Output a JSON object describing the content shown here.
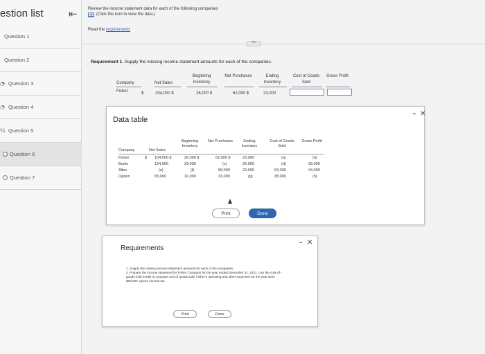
{
  "sidebar": {
    "title": "estion list",
    "collapse_icon": "double-chevron-left-icon",
    "questions": [
      {
        "label": "Question 1",
        "icon": "",
        "status": "none"
      },
      {
        "label": "Question 2",
        "icon": "",
        "status": "none"
      },
      {
        "label": "Question 3",
        "icon": "partial-circle-icon",
        "glyph": "◔",
        "status": "partial"
      },
      {
        "label": "Question 4",
        "icon": "partial-circle-icon",
        "glyph": "◔",
        "status": "partial"
      },
      {
        "label": "Question 5",
        "icon": "half-check-icon",
        "glyph": "⅍",
        "status": "partial"
      },
      {
        "label": "Question 6",
        "icon": "radio-icon",
        "glyph": "",
        "status": "current"
      },
      {
        "label": "Question 7",
        "icon": "radio-icon",
        "glyph": "",
        "status": "none"
      }
    ]
  },
  "intro": {
    "line1": "Review the income statement data for each of the following companies",
    "line2": "(Click the icon to view the data.)",
    "read_prefix": "Read the ",
    "read_link": "requirements"
  },
  "more_pill": "•••",
  "requirement1": {
    "label": "Requirement 1.",
    "text": " Supply the missing income statement amounts for each of the companies."
  },
  "main_table": {
    "headers": [
      "Company",
      "Net Sales",
      "Beginning Inventory",
      "Net Purchases",
      "Ending Inventory",
      "Cost of Goods Sold",
      "Gross Profit"
    ],
    "row": {
      "company": "Fisher",
      "currency": "$",
      "net_sales": "104,000 $",
      "beginning_inventory": "26,000 $",
      "net_purchases": "62,000 $",
      "ending_inventory": "23,000"
    }
  },
  "data_table_dialog": {
    "title": "Data table",
    "minimize_icon": "minimize-icon",
    "close_icon": "close-icon",
    "headers": [
      "Company",
      "Net Sales",
      "Beginning Inventory",
      "Net Purchases",
      "Ending Inventory",
      "Cost of Goods Sold",
      "Gross Profit"
    ],
    "rows": [
      {
        "company": "Fisher",
        "currency": "$",
        "net_sales": "104,000 $",
        "beg_inv": "26,000 $",
        "net_purch": "62,000 $",
        "end_inv": "23,000",
        "cogs": "(a)",
        "gross": "(b)"
      },
      {
        "company": "Burke",
        "currency": "",
        "net_sales": "134,000",
        "beg_inv": "29,000",
        "net_purch": "(c)",
        "end_inv": "26,000",
        "cogs": "(d)",
        "gross": "39,000"
      },
      {
        "company": "Allen",
        "currency": "",
        "net_sales": "(e)",
        "beg_inv": "(f)",
        "net_purch": "58,000",
        "end_inv": "22,000",
        "cogs": "63,000",
        "gross": "34,000"
      },
      {
        "company": "Ogden",
        "currency": "",
        "net_sales": "83,000",
        "beg_inv": "10,000",
        "net_purch": "33,000",
        "end_inv": "(g)",
        "cogs": "38,000",
        "gross": "(h)"
      }
    ],
    "print_label": "Print",
    "done_label": "Done"
  },
  "requirements_dialog": {
    "title": "Requirements",
    "minimize_icon": "minimize-icon",
    "close_icon": "close-icon",
    "items": [
      "1. Supply the missing income statement amounts for each of the companies.",
      "2. Prepare the income statement for Fisher Company for the year ended December 31, 2021. Use the cost-of-goods-sold model to compute cost of goods sold. Fisher's operating and other expenses for the year were $30,000. Ignore income tax."
    ],
    "print_label": "Print",
    "done_label": "Done"
  },
  "colors": {
    "accent": "#2f67b3",
    "link": "#3465b0"
  }
}
